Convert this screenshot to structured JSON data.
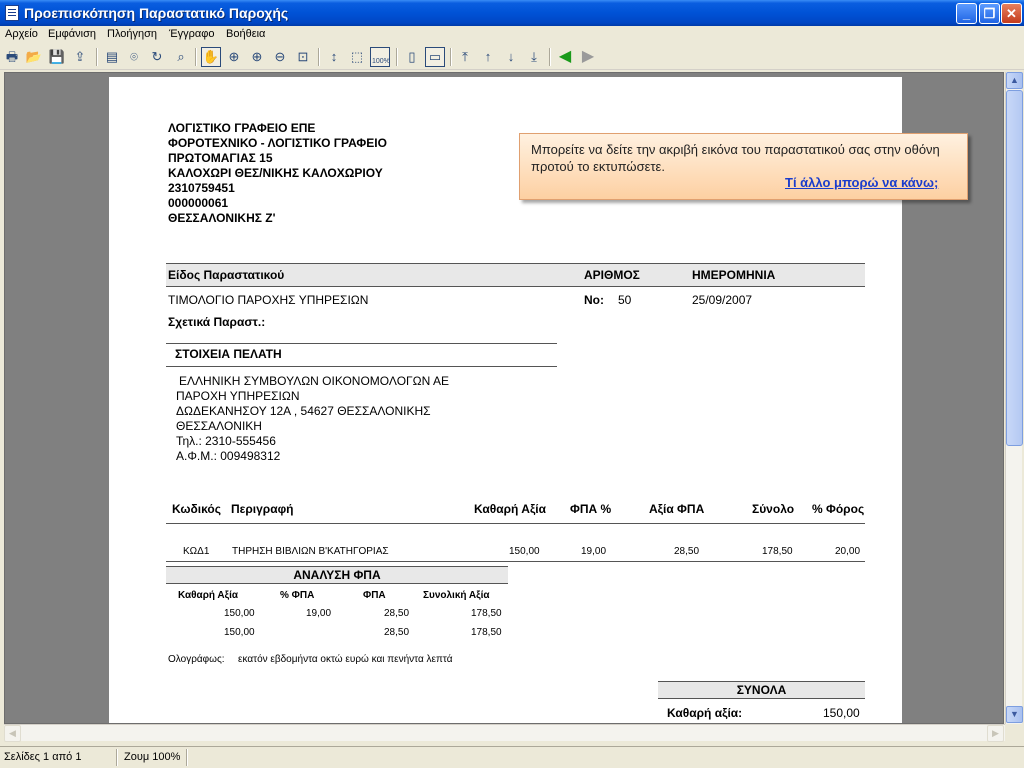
{
  "window": {
    "title": "Προεπισκόπηση Παραστατικό Παροχής",
    "buttons": {
      "minimize": "_",
      "maximize": "❐",
      "close": "✕"
    }
  },
  "menu": [
    "Αρχείο",
    "Εμφάνιση",
    "Πλοήγηση",
    "Έγγραφο",
    "Βοήθεια"
  ],
  "toolbar": {
    "icons": [
      "print-icon",
      "open-folder-icon",
      "save-icon",
      "export-icon",
      "table-icon",
      "binoculars-icon",
      "refresh-icon",
      "page-search-icon",
      "hand-icon",
      "zoom-in-icon",
      "zoom-in-2-icon",
      "zoom-out-icon",
      "zoom-region-icon",
      "fit-height-icon",
      "fit-page-icon",
      "zoom-100-icon",
      "single-page-icon",
      "two-page-icon",
      "first-page-icon",
      "prev-page-icon",
      "next-page-icon",
      "last-page-icon",
      "back-icon",
      "forward-icon"
    ],
    "zoom100_label": "100%"
  },
  "document": {
    "company": [
      "ΛΟΓΙΣΤΙΚΟ ΓΡΑΦΕΙΟ ΕΠΕ",
      "ΦΟΡΟΤΕΧΝΙΚΟ - ΛΟΓΙΣΤΙΚΟ ΓΡΑΦΕΙΟ",
      "ΠΡΩΤΟΜΑΓΙΑΣ 15",
      "ΚΑΛΟΧΩΡΙ ΘΕΣ/ΝΙΚΗΣ ΚΑΛΟΧΩΡΙΟΥ",
      "2310759451",
      "000000061",
      "ΘΕΣΣΑΛΟΝΙΚΗΣ Ζ'"
    ],
    "doc_header": {
      "type_label": "Είδος Παραστατικού",
      "number_label": "ΑΡΙΘΜΟΣ",
      "date_label": "ΗΜΕΡΟΜΗΝΙΑ",
      "type_value": "ΤΙΜΟΛΟΓΙΟ ΠΑΡΟΧΗΣ ΥΠΗΡΕΣΙΩΝ",
      "number_prefix": "No:",
      "number_value": "50",
      "date_value": "25/09/2007",
      "related_label": "Σχετικά Παραστ.:"
    },
    "customer": {
      "heading": "ΣΤΟΙΧΕΙΑ ΠΕΛΑΤΗ",
      "lines": [
        "ΕΛΛΗΝΙΚΗ ΣΥΜΒΟΥΛΩΝ ΟΙΚΟΝΟΜΟΛΟΓΩΝ ΑΕ",
        "ΠΑΡΟΧΗ ΥΠΗΡΕΣΙΩΝ",
        "ΔΩΔΕΚΑΝΗΣΟΥ 12Α , 54627 ΘΕΣΣΑΛΟΝΙΚΗΣ",
        "ΘΕΣΣΑΛΟΝΙΚΗ",
        "Τηλ.: 2310-555456",
        "Α.Φ.Μ.: 009498312"
      ]
    },
    "items_header": [
      "Κωδικός",
      "Περιγραφή",
      "Καθαρή Αξία",
      "ΦΠΑ %",
      "Αξία ΦΠΑ",
      "Σύνολο",
      "% Φόρος"
    ],
    "items": [
      {
        "code": "ΚΩΔ1",
        "description": "ΤΗΡΗΣΗ ΒΙΒΛΙΩΝ Β'ΚΑΤΗΓΟΡΙΑΣ",
        "net": "150,00",
        "vat_pct": "19,00",
        "vat_amount": "28,50",
        "total": "178,50",
        "tax_pct": "20,00"
      }
    ],
    "vat_analysis": {
      "title": "ΑΝΑΛΥΣΗ ΦΠΑ",
      "columns": [
        "Καθαρή Αξία",
        "% ΦΠΑ",
        "ΦΠΑ",
        "Συνολική Αξία"
      ],
      "rows": [
        {
          "net": "150,00",
          "pct": "19,00",
          "vat": "28,50",
          "total": "178,50"
        },
        {
          "net": "150,00",
          "pct": "",
          "vat": "28,50",
          "total": "178,50"
        }
      ]
    },
    "in_words_label": "Ολογράφως:",
    "in_words_value": "εκατόν εβδομήντα οκτώ ευρώ και πενήντα λεπτά",
    "totals": {
      "title": "ΣΥΝΟΛΑ",
      "net_label": "Καθαρή αξία:",
      "net_value": "150,00"
    }
  },
  "balloon": {
    "message": "Μπορείτε να δείτε την ακριβή εικόνα του παραστατικού σας στην οθόνη προτού το εκτυπώσετε.",
    "link": "Τί άλλο μπορώ να κάνω;"
  },
  "status": {
    "pages": "Σελίδες 1 από 1",
    "zoom": "Ζουμ 100%"
  }
}
